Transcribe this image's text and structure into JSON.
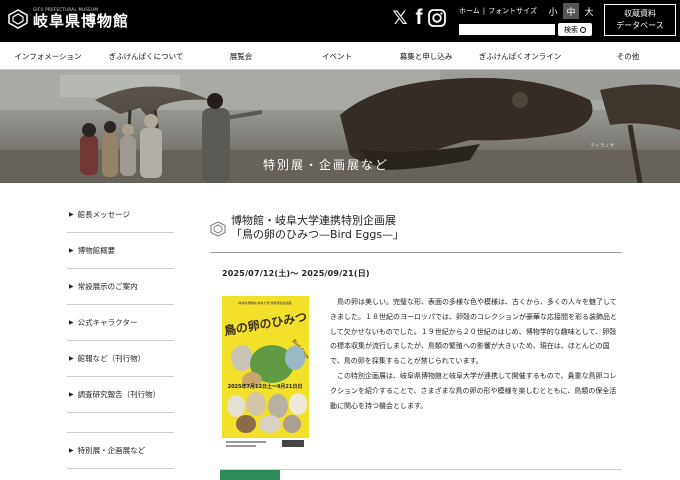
{
  "header": {
    "logo_en": "GIFU PREFECTURAL MUSEUM",
    "logo_ja": "岐阜県博物館",
    "social": {
      "x": "𝕏",
      "facebook": "f",
      "instagram_icon": "instagram-icon"
    },
    "links": {
      "home": "ホーム",
      "sep": "|",
      "fontsize": "フォントサイズ"
    },
    "font_sizes": [
      "小",
      "中",
      "大"
    ],
    "font_size_active": "中",
    "search_placeholder": "",
    "search_button": "検索",
    "collection_db": [
      "収蔵資料",
      "データベース"
    ]
  },
  "nav": {
    "items": [
      "インフォメーション",
      "ぎふけんぱくについて",
      "展覧会",
      "イベント",
      "募集と申し込み",
      "ぎふけんぱくオンライン",
      "その他"
    ]
  },
  "hero": {
    "title": "特別展・企画展など",
    "sign": "ティラノサ"
  },
  "sidebar": {
    "items": [
      "館長メッセージ",
      "博物館概要",
      "常設展示のご案内",
      "公式キャラクター",
      "館報など（刊行物）",
      "調査研究報告（刊行物）",
      "特別展・企画展など"
    ],
    "arrow": "▶"
  },
  "main": {
    "title_line1": "博物館・岐阜大学連携特別企画展",
    "title_line2": "「鳥の卵のひみつ—Bird Eggs—」",
    "date": "2025/07/12(土)～ 2025/09/21(日)",
    "poster": {
      "top_text": "岐阜県博物館 岐阜大学 連携特別企画展",
      "title": "鳥の卵のひみつ",
      "subtitle": "Bird Eggs",
      "date_text": "2025年7月12日土～9月21日日"
    },
    "paragraph1": "鳥の卵は美しい。完璧な形、表面の多様な色や模様は、古くから、多くの人々を魅了してきました。１８世紀のヨーロッパでは、卵殻のコレクションが豪華な応接間を彩る装飾品として欠かせないものでした。１９世紀から２０世紀のはじめ、博物学的な趣味として、卵殻の標本収集が流行しましたが、鳥類の繁殖への影響が大きいため、現在は、ほとんどの国で、鳥の卵を採集することが禁じられています。",
    "paragraph2": "この特別企画展は、岐阜県博物館と岐阜大学が連携して開催するもので、貴重な鳥卵コレクションを紹介することで、さまざまな鳥の卵の形や模様を楽しむとともに、鳥類の保全活動に関心を持つ機会とします。"
  },
  "colors": {
    "header_bg": "#000000",
    "poster_yellow": "#f2e02a",
    "accent_green": "#2e8b57"
  }
}
